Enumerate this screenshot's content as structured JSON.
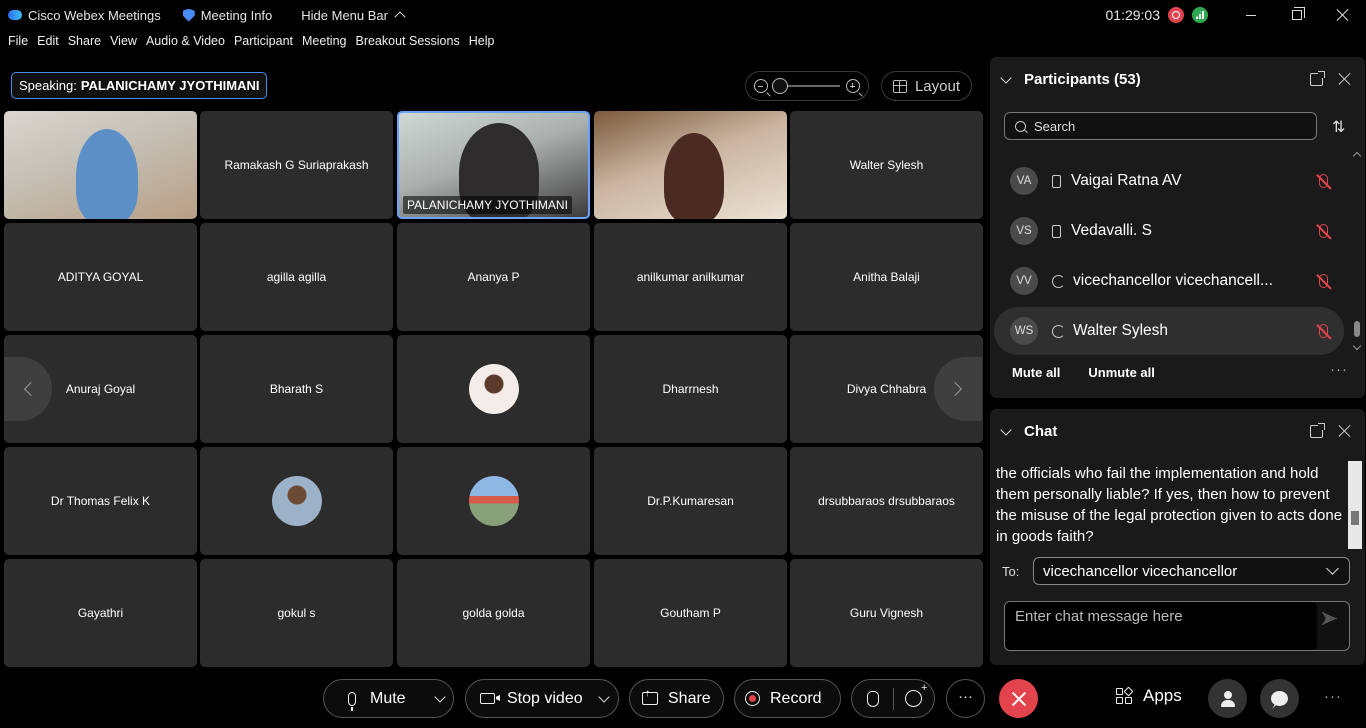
{
  "titlebar": {
    "app_name": "Cisco Webex Meetings",
    "meeting_info": "Meeting Info",
    "hide_menu": "Hide Menu Bar",
    "clock": "01:29:03"
  },
  "menu": [
    "File",
    "Edit",
    "Share",
    "View",
    "Audio & Video",
    "Participant",
    "Meeting",
    "Breakout Sessions",
    "Help"
  ],
  "speaking": {
    "label": "Speaking:",
    "name": "PALANICHAMY JYOTHIMANI"
  },
  "layout_label": "Layout",
  "tiles": [
    {
      "name": "",
      "kind": "video1"
    },
    {
      "name": "Ramakash G Suriaprakash",
      "kind": "name"
    },
    {
      "name": "PALANICHAMY JYOTHIMANI",
      "kind": "video3"
    },
    {
      "name": "",
      "kind": "video4"
    },
    {
      "name": "Walter Sylesh",
      "kind": "name"
    },
    {
      "name": "ADITYA GOYAL",
      "kind": "name"
    },
    {
      "name": "agilla agilla",
      "kind": "name"
    },
    {
      "name": "Ananya P",
      "kind": "name"
    },
    {
      "name": "anilkumar anilkumar",
      "kind": "name"
    },
    {
      "name": "Anitha Balaji",
      "kind": "name"
    },
    {
      "name": "Anuraj Goyal",
      "kind": "name"
    },
    {
      "name": "Bharath S",
      "kind": "name"
    },
    {
      "name": "",
      "kind": "av1"
    },
    {
      "name": "Dharrnesh",
      "kind": "name"
    },
    {
      "name": "Divya Chhabra",
      "kind": "name"
    },
    {
      "name": "Dr Thomas Felix K",
      "kind": "name"
    },
    {
      "name": "",
      "kind": "av2"
    },
    {
      "name": "",
      "kind": "av3"
    },
    {
      "name": "Dr.P.Kumaresan",
      "kind": "name"
    },
    {
      "name": "drsubbaraos drsubbaraos",
      "kind": "name"
    },
    {
      "name": "Gayathri",
      "kind": "name"
    },
    {
      "name": "gokul s",
      "kind": "name"
    },
    {
      "name": "golda golda",
      "kind": "name"
    },
    {
      "name": "Goutham P",
      "kind": "name"
    },
    {
      "name": "Guru Vignesh",
      "kind": "name"
    }
  ],
  "participants": {
    "title": "Participants (53)",
    "search_placeholder": "Search",
    "list": [
      {
        "initials": "VA",
        "name": "Vaigai Ratna AV",
        "device": "phone"
      },
      {
        "initials": "VS",
        "name": "Vedavalli. S",
        "device": "phone"
      },
      {
        "initials": "VV",
        "name": "vicechancellor vicechancell...",
        "device": "sync"
      },
      {
        "initials": "WS",
        "name": "Walter Sylesh",
        "device": "sync"
      }
    ],
    "mute_all": "Mute all",
    "unmute_all": "Unmute all"
  },
  "chat": {
    "title": "Chat",
    "message": "the officials who fail the implementation and hold them personally liable? If yes, then how to prevent the misuse of the legal protection given to acts done in goods faith?",
    "to_label": "To:",
    "to_value": "vicechancellor vicechancellor",
    "input_placeholder": "Enter chat message here"
  },
  "toolbar": {
    "mute": "Mute",
    "stop_video": "Stop video",
    "share": "Share",
    "record": "Record",
    "apps": "Apps"
  },
  "colors": {
    "accent": "#4c8cf3",
    "danger": "#e2434c",
    "tile_bg": "#2c2c2c",
    "panel_bg": "#1a1a1a"
  }
}
